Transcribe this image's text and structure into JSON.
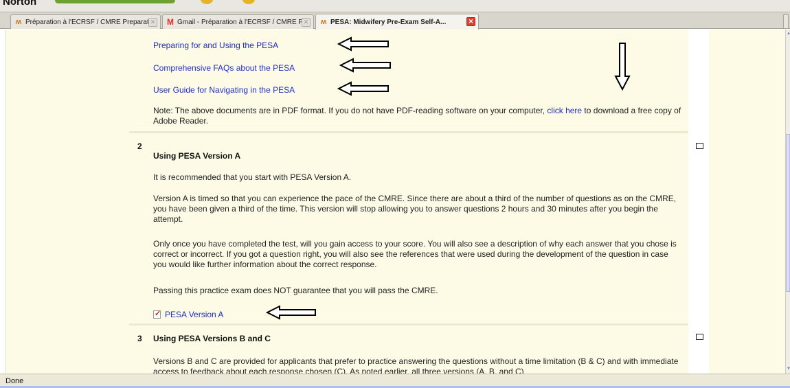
{
  "toolbar": {
    "brand": "Norton"
  },
  "tabs": [
    {
      "title": "Préparation à l'ECRSF / CMRE Preparati...",
      "icon": "moodle-icon"
    },
    {
      "title": "Gmail - Préparation à l'ECRSF / CMRE P...",
      "icon": "gmail-icon"
    },
    {
      "title": "PESA: Midwifery Pre-Exam Self-A...",
      "icon": "moodle-icon"
    }
  ],
  "section1": {
    "links": [
      "Preparing for and Using the PESA",
      "Comprehensive FAQs about the PESA",
      "User Guide for Navigating in the PESA"
    ],
    "note_before": "Note: The above documents are in PDF format. If you do not have PDF-reading software on your computer, ",
    "note_link": "click here",
    "note_after": " to download a free copy of Adobe Reader."
  },
  "section2": {
    "number": "2",
    "heading": "Using PESA Version A",
    "p1": "It is recommended that you start with PESA Version A.",
    "p2": "Version A is timed so that you can experience the pace of the CMRE. Since there are about a third of the number of questions as on the CMRE, you have been given a third of the time. This version will stop allowing you to answer questions 2 hours and 30 minutes after you begin the attempt.",
    "p3": "Only once you have completed the test, will you gain access to your score. You will also see a description of why each answer that you chose is correct or incorrect. If you got a question right, you will also see the references that were used during the development of the question in case you would like further information about the correct response.",
    "p4": "Passing this practice exam does NOT guarantee that you will pass the CMRE.",
    "resource_link": "PESA Version A"
  },
  "section3": {
    "number": "3",
    "heading": "Using PESA Versions B and C",
    "p1": "Versions B and C are provided for applicants that prefer to practice answering the questions without a time limitation (B & C) and with immediate access to feedback about each response chosen (C). As noted earlier, all three versions (A, B, and C)"
  },
  "status": {
    "text": "Done"
  }
}
